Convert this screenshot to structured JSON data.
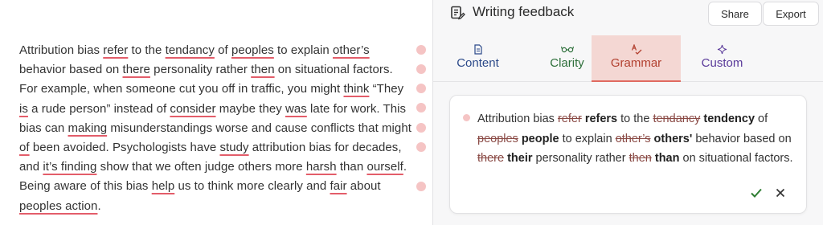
{
  "essay": {
    "segments": [
      {
        "t": "Attribution bias "
      },
      {
        "t": "refer",
        "flag": true
      },
      {
        "t": " to the "
      },
      {
        "t": "tendancy",
        "flag": true
      },
      {
        "t": " of "
      },
      {
        "t": "peoples",
        "flag": true
      },
      {
        "t": " to explain "
      },
      {
        "t": "other’s",
        "flag": true
      },
      {
        "t": " behavior based on "
      },
      {
        "t": "there",
        "flag": true
      },
      {
        "t": " personality rather "
      },
      {
        "t": "then",
        "flag": true
      },
      {
        "t": " on situational factors. For example, when someone cut you off in traffic, you might "
      },
      {
        "t": "think",
        "flag": true
      },
      {
        "t": " “They "
      },
      {
        "t": "is",
        "flag": true
      },
      {
        "t": " a rude person” instead of "
      },
      {
        "t": "consider",
        "flag": true
      },
      {
        "t": " maybe they "
      },
      {
        "t": "was",
        "flag": true
      },
      {
        "t": " late for work. This bias can "
      },
      {
        "t": "making",
        "flag": true
      },
      {
        "t": " misunderstandings worse and cause conflicts that might "
      },
      {
        "t": "of",
        "flag": true
      },
      {
        "t": " been avoided. Psychologists have "
      },
      {
        "t": "study",
        "flag": true
      },
      {
        "t": " attribution bias for decades, and "
      },
      {
        "t": "it’s finding",
        "flag": true
      },
      {
        "t": " show that we often judge others more "
      },
      {
        "t": "harsh",
        "flag": true
      },
      {
        "t": " than "
      },
      {
        "t": "ourself",
        "flag": true
      },
      {
        "t": ". Being aware of this bias "
      },
      {
        "t": "help",
        "flag": true
      },
      {
        "t": " us to think more clearly and "
      },
      {
        "t": "fair",
        "flag": true
      },
      {
        "t": " about "
      },
      {
        "t": "peoples action",
        "flag": true
      },
      {
        "t": "."
      }
    ]
  },
  "panel": {
    "title": "Writing feedback",
    "share_label": "Share",
    "export_label": "Export",
    "tabs": [
      {
        "label": "Content",
        "icon": "document-icon",
        "color": "#2c4a8a"
      },
      {
        "label": "Clarity",
        "icon": "glasses-icon",
        "color": "#2d6f3a"
      },
      {
        "label": "Grammar",
        "icon": "spellcheck-icon",
        "color": "#b2402f",
        "active": true
      },
      {
        "label": "Custom",
        "icon": "sparkle-icon",
        "color": "#5a3a9a"
      }
    ]
  },
  "suggestion": {
    "segments": [
      {
        "t": "Attribution bias "
      },
      {
        "t": "refer",
        "kind": "del"
      },
      {
        "t": " "
      },
      {
        "t": "refers",
        "kind": "ins"
      },
      {
        "t": " to the "
      },
      {
        "t": "tendancy",
        "kind": "del"
      },
      {
        "t": " "
      },
      {
        "t": "tendency",
        "kind": "ins"
      },
      {
        "t": " of "
      },
      {
        "t": "peoples",
        "kind": "del"
      },
      {
        "t": " "
      },
      {
        "t": "people",
        "kind": "ins"
      },
      {
        "t": " to explain "
      },
      {
        "t": "other’s",
        "kind": "del"
      },
      {
        "t": " "
      },
      {
        "t": "others'",
        "kind": "ins"
      },
      {
        "t": " behavior based on "
      },
      {
        "t": "there",
        "kind": "del"
      },
      {
        "t": " "
      },
      {
        "t": "their",
        "kind": "ins"
      },
      {
        "t": " personality rather "
      },
      {
        "t": "then",
        "kind": "del"
      },
      {
        "t": " "
      },
      {
        "t": "than",
        "kind": "ins"
      },
      {
        "t": " on situational factors."
      }
    ]
  },
  "colors": {
    "accent_red": "#e06a60",
    "underline_red": "#e35d6a",
    "dot_pink": "#f5c4c4",
    "active_tab_bg": "#f4d7d3",
    "accept_green": "#2e7d32"
  }
}
